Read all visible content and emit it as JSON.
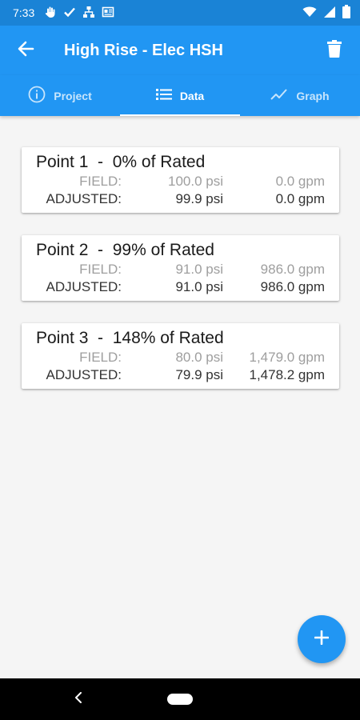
{
  "status_bar": {
    "time": "7:33",
    "left_icons": [
      "hand-icon",
      "check-icon",
      "network-icon",
      "newsfeed-icon"
    ],
    "right_icons": [
      "wifi-icon",
      "signal-icon",
      "battery-icon"
    ]
  },
  "appbar": {
    "title": "High Rise - Elec HSH",
    "back_icon": "arrow-left-icon",
    "delete_icon": "trash-icon"
  },
  "tabs": [
    {
      "label": "Project",
      "icon": "info-icon",
      "active": false
    },
    {
      "label": "Data",
      "icon": "list-icon",
      "active": true
    },
    {
      "label": "Graph",
      "icon": "line-chart-icon",
      "active": false
    }
  ],
  "points": [
    {
      "title": "Point 1  -  0% of Rated",
      "field_label": "FIELD:",
      "field_psi": "100.0 psi",
      "field_gpm": "0.0 gpm",
      "adjusted_label": "ADJUSTED:",
      "adjusted_psi": "99.9 psi",
      "adjusted_gpm": "0.0 gpm"
    },
    {
      "title": "Point 2  -  99% of Rated",
      "field_label": "FIELD:",
      "field_psi": "91.0 psi",
      "field_gpm": "986.0 gpm",
      "adjusted_label": "ADJUSTED:",
      "adjusted_psi": "91.0 psi",
      "adjusted_gpm": "986.0 gpm"
    },
    {
      "title": "Point 3  -  148% of Rated",
      "field_label": "FIELD:",
      "field_psi": "80.0 psi",
      "field_gpm": "1,479.0 gpm",
      "adjusted_label": "ADJUSTED:",
      "adjusted_psi": "79.9 psi",
      "adjusted_gpm": "1,478.2 gpm"
    }
  ],
  "fab_icon": "plus-icon",
  "colors": {
    "primary": "#2196f3",
    "primary_dark": "#1a83d6",
    "field_text": "#9e9e9e",
    "adjusted_text": "#333333"
  }
}
